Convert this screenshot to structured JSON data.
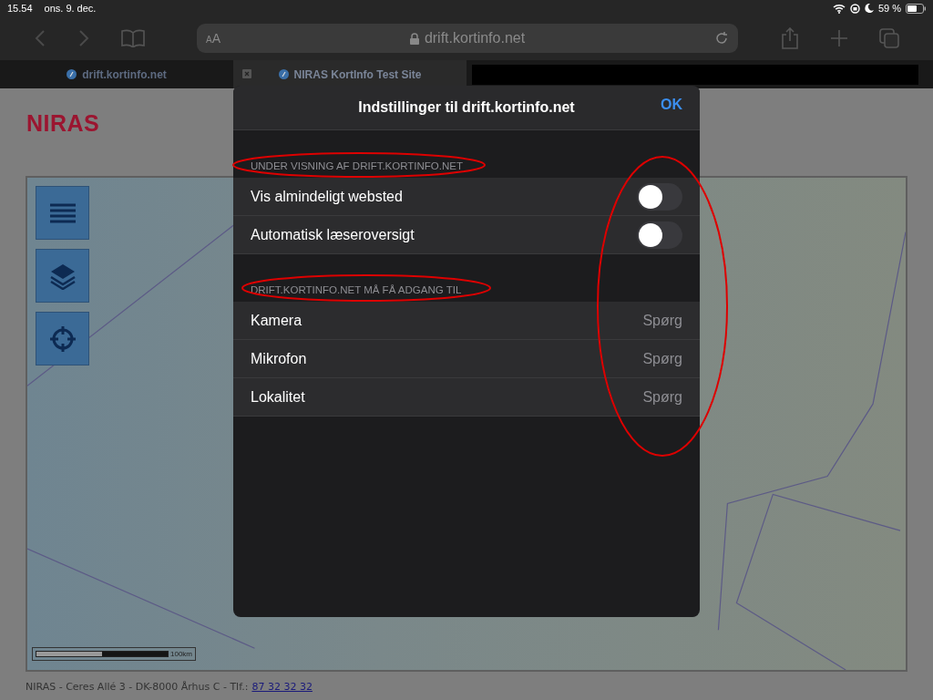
{
  "status_bar": {
    "time": "15.54",
    "date": "ons. 9. dec.",
    "battery": "59 %"
  },
  "toolbar": {
    "text_size": "AA",
    "url": "drift.kortinfo.net"
  },
  "tabs": [
    {
      "title": "drift.kortinfo.net",
      "selected": false
    },
    {
      "title": "NIRAS KortInfo Test Site",
      "selected": true
    }
  ],
  "page": {
    "logo": "NIRAS",
    "scale_label": "100km",
    "footer": "NIRAS - Ceres Allé 3 - DK-8000 Århus C - Tlf.:",
    "phone": "87 32 32 32"
  },
  "dialog": {
    "title": "Indstillinger til drift.kortinfo.net",
    "ok": "OK",
    "sections": [
      {
        "header": "UNDER VISNING AF DRIFT.KORTINFO.NET",
        "rows": [
          {
            "kind": "toggle",
            "label": "Vis almindeligt websted",
            "on": false
          },
          {
            "kind": "toggle",
            "label": "Automatisk læseroversigt",
            "on": false
          }
        ]
      },
      {
        "header": "DRIFT.KORTINFO.NET MÅ FÅ ADGANG TIL",
        "rows": [
          {
            "kind": "value",
            "label": "Kamera",
            "value": "Spørg"
          },
          {
            "kind": "value",
            "label": "Mikrofon",
            "value": "Spørg"
          },
          {
            "kind": "value",
            "label": "Lokalitet",
            "value": "Spørg"
          }
        ]
      }
    ]
  }
}
